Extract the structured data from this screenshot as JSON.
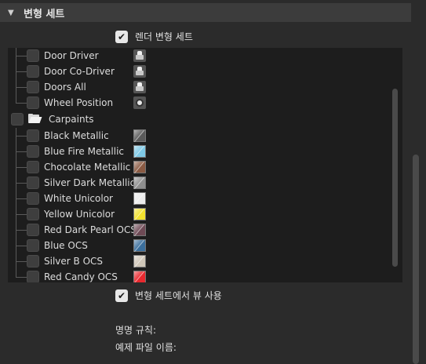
{
  "section": {
    "title": "변형 세트",
    "collapse_icon": "triangle-down-icon"
  },
  "render_variant_sets": {
    "label": "렌더 변형 세트",
    "checked": true
  },
  "tree": {
    "items": [
      {
        "name": "Door Driver",
        "icon": "car-door-icon",
        "checked": false
      },
      {
        "name": "Door Co-Driver",
        "icon": "car-door-icon",
        "checked": false
      },
      {
        "name": "Doors All",
        "icon": "car-door-icon",
        "checked": false
      },
      {
        "name": "Wheel Position",
        "icon": "wheel-icon",
        "checked": false
      }
    ],
    "group": {
      "name": "Carpaints",
      "icon": "folder-open-icon",
      "checked": false
    },
    "paints": [
      {
        "name": "Black Metallic",
        "color": "#5a5a5a",
        "checked": false
      },
      {
        "name": "Blue Fire Metallic",
        "color": "#7ec9e6",
        "checked": false
      },
      {
        "name": "Chocolate Metallic",
        "color": "#8a5a43",
        "checked": false
      },
      {
        "name": "Silver Dark Metallic",
        "color": "#8e8e8e",
        "checked": false
      },
      {
        "name": "White Unicolor",
        "color": "#ececec",
        "checked": false
      },
      {
        "name": "Yellow Unicolor",
        "color": "#f2e22e",
        "checked": false
      },
      {
        "name": "Red Dark Pearl OCS",
        "color": "#6e4a55",
        "checked": false
      },
      {
        "name": "Blue OCS",
        "color": "#3a6e9c",
        "checked": false
      },
      {
        "name": "Silver B OCS",
        "color": "#cfc6b8",
        "checked": false
      },
      {
        "name": "Red Candy OCS",
        "color": "#e8282e",
        "checked": false
      }
    ]
  },
  "use_view_from_variant_sets": {
    "label": "변형 세트에서 뷰 사용",
    "checked": true
  },
  "naming_rule_label": "명명 규칙:",
  "example_filename_label": "예제 파일 이름:"
}
